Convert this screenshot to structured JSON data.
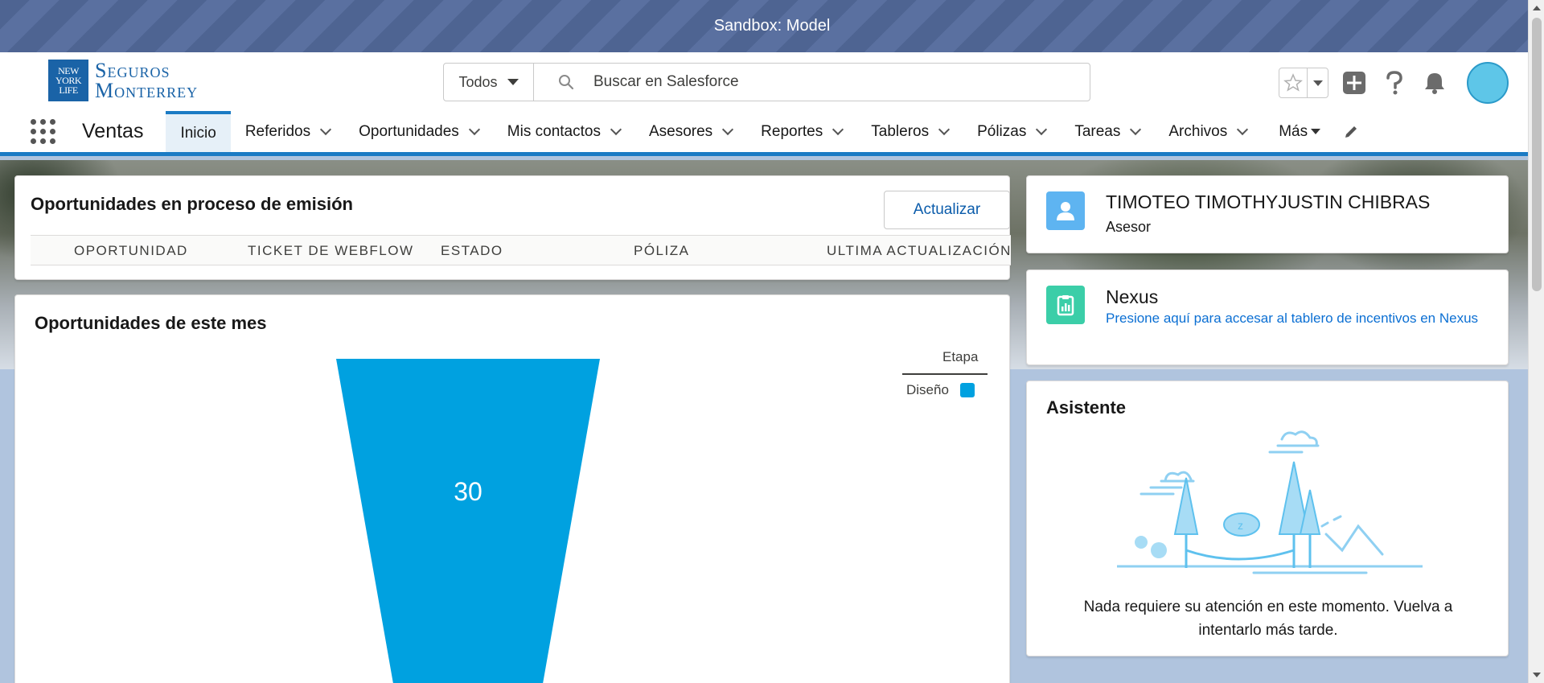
{
  "sandbox": {
    "label": "Sandbox: Model"
  },
  "logo": {
    "badge_line1": "NEW",
    "badge_line2": "YORK",
    "badge_line3": "LIFE",
    "line1": "Seguros",
    "line2": "Monterrey"
  },
  "search": {
    "scope": "Todos",
    "placeholder": "Buscar en Salesforce"
  },
  "header_icons": [
    "star-icon",
    "plus-icon",
    "help-icon",
    "bell-icon",
    "avatar"
  ],
  "nav": {
    "app_name": "Ventas",
    "items": [
      {
        "label": "Inicio",
        "active": true
      },
      {
        "label": "Referidos"
      },
      {
        "label": "Oportunidades"
      },
      {
        "label": "Mis contactos"
      },
      {
        "label": "Asesores"
      },
      {
        "label": "Reportes"
      },
      {
        "label": "Tableros"
      },
      {
        "label": "Pólizas"
      },
      {
        "label": "Tareas"
      },
      {
        "label": "Archivos"
      }
    ],
    "more": "Más"
  },
  "emision": {
    "title": "Oportunidades en proceso de emisión",
    "update_button": "Actualizar",
    "columns": [
      "OPORTUNIDAD",
      "TICKET DE WEBFLOW",
      "ESTADO",
      "PÓLIZA",
      "ULTIMA ACTUALIZACIÓN"
    ]
  },
  "opps": {
    "title": "Oportunidades de este mes",
    "legend_title": "Etapa"
  },
  "chart_data": {
    "type": "funnel",
    "categories": [
      "Diseño"
    ],
    "values": [
      30
    ],
    "legend": {
      "title": "Etapa",
      "position": "top-right",
      "entries": [
        "Diseño"
      ]
    },
    "colors": [
      "#00a1e0"
    ]
  },
  "user": {
    "name": "TIMOTEO TIMOTHYJUSTIN CHIBRAS",
    "role": "Asesor"
  },
  "nexus": {
    "title": "Nexus",
    "link": "Presione aquí para accesar al tablero de incentivos en Nexus"
  },
  "asistente": {
    "title": "Asistente",
    "message": "Nada requiere su atención en este momento. Vuelva a intentarlo más tarde."
  },
  "colors": {
    "accent": "#1b7bc4",
    "funnel": "#00a1e0",
    "link": "#0b6fd3",
    "banner": "#4e6492"
  }
}
